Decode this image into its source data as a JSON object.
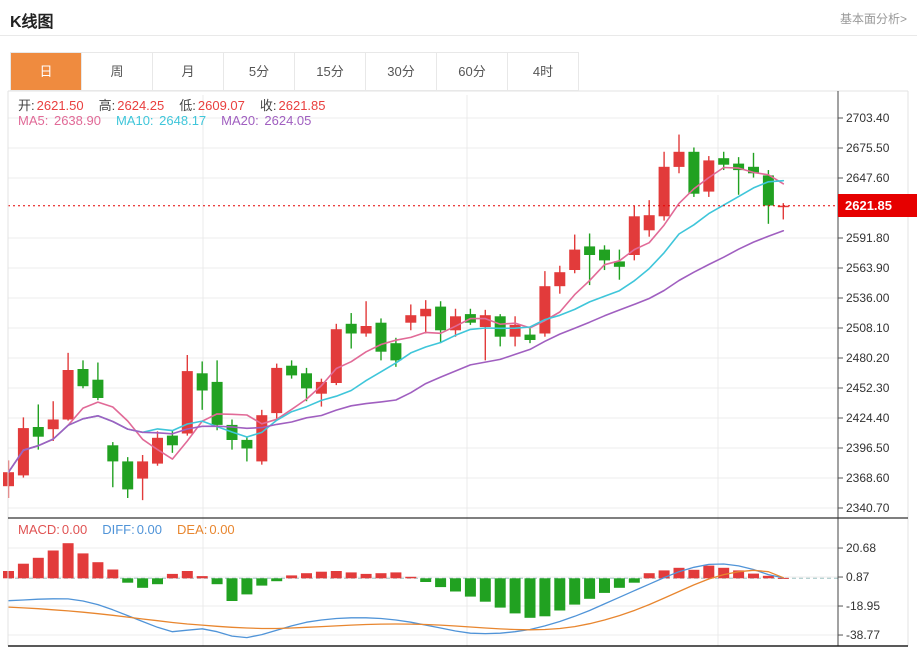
{
  "header": {
    "title": "K线图",
    "link": "基本面分析>"
  },
  "tabs": {
    "items": [
      {
        "id": "day",
        "label": "日",
        "active": true
      },
      {
        "id": "week",
        "label": "周",
        "active": false
      },
      {
        "id": "month",
        "label": "月",
        "active": false
      },
      {
        "id": "m5",
        "label": "5分",
        "active": false
      },
      {
        "id": "m15",
        "label": "15分",
        "active": false
      },
      {
        "id": "m30",
        "label": "30分",
        "active": false
      },
      {
        "id": "m60",
        "label": "60分",
        "active": false
      },
      {
        "id": "h4",
        "label": "4时",
        "active": false
      }
    ]
  },
  "legend": {
    "ohlc": [
      {
        "label": "开:",
        "value": "2621.50"
      },
      {
        "label": "高:",
        "value": "2624.25"
      },
      {
        "label": "低:",
        "value": "2609.07"
      },
      {
        "label": "收:",
        "value": "2621.85"
      }
    ],
    "ma": [
      {
        "label": "MA5:",
        "value": "2638.90"
      },
      {
        "label": "MA10:",
        "value": "2648.17"
      },
      {
        "label": "MA20:",
        "value": "2624.05"
      }
    ],
    "macd": [
      {
        "label": "MACD:",
        "value": "0.00"
      },
      {
        "label": "DIFF:",
        "value": "0.00"
      },
      {
        "label": "DEA:",
        "value": "0.00"
      }
    ]
  },
  "price_line": {
    "value": 2621.85,
    "label": "2621.85"
  },
  "colors": {
    "accent": "#ef8b3f",
    "up": "#e23b3b",
    "down": "#21a121",
    "ma5": "#e16a97",
    "ma10": "#3fc6da",
    "ma20": "#a05fc0",
    "diff": "#5094d8",
    "dea": "#e8862f",
    "price_red": "#e60000",
    "value_red": "#e9403f",
    "macd_red": "#e05353",
    "grid": "#ececec",
    "axis_dark": "#333333",
    "border_light": "#e3e3e3",
    "tick_text": "#333333",
    "zero_dash": "#9fc4c4"
  },
  "chart_data": {
    "type": "candlestick",
    "title": "K线图 daily gold candlestick with MA(5,10,20) and MACD",
    "panes": [
      {
        "name": "price",
        "y_ticks": [
          2703.4,
          2675.5,
          2647.6,
          2591.8,
          2563.9,
          2536.0,
          2508.1,
          2480.2,
          2452.3,
          2424.4,
          2396.5,
          2368.6,
          2340.7
        ],
        "y_range": [
          2331.0,
          2729.0
        ],
        "price_line": 2621.85,
        "ma_windows": [
          5,
          10,
          20
        ],
        "candles": [
          [
            2361,
            2385,
            2350,
            2374
          ],
          [
            2371,
            2425,
            2369,
            2415
          ],
          [
            2416,
            2437,
            2395,
            2407
          ],
          [
            2414,
            2440,
            2403,
            2423
          ],
          [
            2423,
            2485,
            2422,
            2469
          ],
          [
            2470,
            2478,
            2452,
            2454
          ],
          [
            2460,
            2476,
            2441,
            2443
          ],
          [
            2399,
            2402,
            2360,
            2384
          ],
          [
            2384,
            2388,
            2350,
            2358
          ],
          [
            2368,
            2390,
            2348,
            2384
          ],
          [
            2382,
            2412,
            2380,
            2406
          ],
          [
            2408,
            2413,
            2392,
            2399
          ],
          [
            2410,
            2483,
            2408,
            2468
          ],
          [
            2466,
            2477,
            2432,
            2450
          ],
          [
            2458,
            2478,
            2413,
            2418
          ],
          [
            2418,
            2423,
            2395,
            2404
          ],
          [
            2404,
            2407,
            2384,
            2396
          ],
          [
            2384,
            2432,
            2381,
            2427
          ],
          [
            2429,
            2475,
            2424,
            2471
          ],
          [
            2473,
            2478,
            2461,
            2464
          ],
          [
            2466,
            2471,
            2440,
            2452
          ],
          [
            2447,
            2461,
            2435,
            2458
          ],
          [
            2457,
            2512,
            2455,
            2507
          ],
          [
            2512,
            2522,
            2489,
            2503
          ],
          [
            2503,
            2533,
            2500,
            2510
          ],
          [
            2513,
            2517,
            2478,
            2486
          ],
          [
            2494,
            2499,
            2472,
            2478
          ],
          [
            2513,
            2530,
            2506,
            2520
          ],
          [
            2519,
            2534,
            2503,
            2526
          ],
          [
            2528,
            2533,
            2494,
            2506
          ],
          [
            2506,
            2526,
            2500,
            2519
          ],
          [
            2521,
            2526,
            2511,
            2513
          ],
          [
            2509,
            2525,
            2478,
            2520
          ],
          [
            2519,
            2521,
            2491,
            2500
          ],
          [
            2500,
            2519,
            2491,
            2511
          ],
          [
            2502,
            2509,
            2494,
            2497
          ],
          [
            2503,
            2561,
            2500,
            2547
          ],
          [
            2547,
            2566,
            2540,
            2560
          ],
          [
            2562,
            2595,
            2559,
            2581
          ],
          [
            2584,
            2596,
            2548,
            2576
          ],
          [
            2581,
            2585,
            2562,
            2571
          ],
          [
            2570,
            2581,
            2553,
            2565
          ],
          [
            2576,
            2622,
            2571,
            2612
          ],
          [
            2599,
            2627,
            2593,
            2613
          ],
          [
            2612,
            2672,
            2608,
            2658
          ],
          [
            2658,
            2688,
            2652,
            2672
          ],
          [
            2672,
            2676,
            2630,
            2633
          ],
          [
            2635,
            2668,
            2630,
            2664
          ],
          [
            2666,
            2672,
            2655,
            2660
          ],
          [
            2661,
            2667,
            2632,
            2655
          ],
          [
            2658,
            2671,
            2648,
            2652
          ],
          [
            2650,
            2655,
            2605,
            2622
          ],
          [
            2621.5,
            2624.25,
            2609.07,
            2621.85
          ]
        ]
      },
      {
        "name": "macd",
        "y_ticks": [
          20.68,
          0.87,
          -18.95,
          -38.77
        ],
        "hist": [
          5,
          10,
          14,
          19,
          24,
          17,
          11,
          6,
          -3,
          -6.5,
          -4,
          3,
          5,
          1.5,
          -4,
          -15.5,
          -11,
          -5,
          -2,
          2,
          3.5,
          4.5,
          5,
          4,
          3,
          3.5,
          4,
          1,
          -2.5,
          -6,
          -9,
          -12.5,
          -16,
          -20,
          -24,
          -27,
          -26,
          -22,
          -18,
          -14,
          -10,
          -6.5,
          -3,
          3.5,
          5.4,
          7.2,
          5.8,
          8.7,
          7.2,
          5.4,
          3.2,
          1.7,
          0.3
        ],
        "diff": [
          -15.3,
          -14.8,
          -14.3,
          -14,
          -14.1,
          -15.5,
          -18,
          -21.5,
          -25.5,
          -29.5,
          -33.5,
          -36.5,
          -35.5,
          -34.5,
          -36.5,
          -39.5,
          -40.5,
          -38.5,
          -35.5,
          -32.5,
          -30,
          -28.5,
          -27.5,
          -27,
          -27,
          -27.5,
          -28.5,
          -30,
          -32,
          -34,
          -36,
          -37.5,
          -37.8,
          -37.5,
          -36.5,
          -35,
          -32.5,
          -29.5,
          -26,
          -22,
          -17.5,
          -13,
          -8.5,
          -4,
          0.5,
          4.5,
          7.5,
          9.5,
          9.8,
          8.5,
          6,
          2.5,
          0.3
        ],
        "dea": [
          -19.7,
          -20.2,
          -20.8,
          -21.5,
          -22.3,
          -23.2,
          -24.2,
          -25.3,
          -26.5,
          -27.8,
          -29,
          -30.2,
          -31.2,
          -32,
          -32.8,
          -33.5,
          -34,
          -34.3,
          -34.3,
          -34,
          -33.5,
          -33,
          -32.5,
          -32,
          -31.6,
          -31.3,
          -31.2,
          -31.3,
          -31.6,
          -32,
          -32.6,
          -33.3,
          -34,
          -34.6,
          -35,
          -35.2,
          -35,
          -34.3,
          -33,
          -31,
          -28.5,
          -25.5,
          -22,
          -18,
          -13.5,
          -9,
          -4.5,
          -0.5,
          2.5,
          4.5,
          5.5,
          4.5,
          0.4
        ]
      }
    ]
  }
}
